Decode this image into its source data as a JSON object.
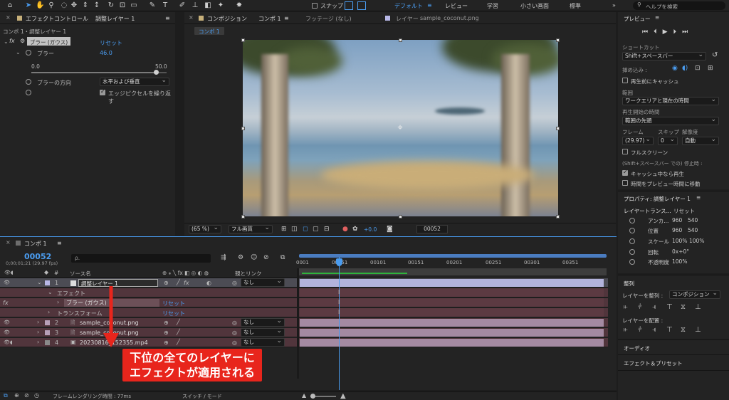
{
  "toolbar": {
    "snap_label": "スナップ",
    "workspaces": [
      "デフォルト",
      "レビュー",
      "学習",
      "小さい画面",
      "標準"
    ],
    "search_placeholder": "ヘルプを検索",
    "more": "»"
  },
  "effect_controls": {
    "tab_label": "エフェクトコントロール",
    "tab_layer": "調整レイヤー 1",
    "breadcrumb": "コンポ 1・調整レイヤー 1",
    "effect_name": "ブラー (ガウス)",
    "reset": "リセット",
    "blur_label": "ブラー",
    "blur_value": "46.0",
    "slider_min": "0.0",
    "slider_max": "50.0",
    "slider_fraction": 0.92,
    "direction_label": "ブラーの方向",
    "direction_value": "水平および垂直",
    "repeat_edge_label": "エッジピクセルを繰り返す"
  },
  "composition": {
    "tab_label": "コンポジション",
    "tab_name": "コンポ 1",
    "footage_tab": "フッテージ (なし)",
    "layer_tab": "レイヤー",
    "layer_name": "sample_coconut.png",
    "comp_chip": "コンポ 1",
    "zoom": "(65 %)",
    "quality": "フル画質",
    "exposure": "+0.0",
    "timecode": "00052"
  },
  "timeline": {
    "tab_label": "コンポ 1",
    "current_frame": "00052",
    "current_time": "0;00;01;21 (29.97 fps)",
    "search_placeholder": "ρ.",
    "col_source": "ソース名",
    "col_parent": "親とリンク",
    "ticks": [
      "0001",
      "00051",
      "00101",
      "00151",
      "00201",
      "00251",
      "00301",
      "00351"
    ],
    "layers": [
      {
        "num": "1",
        "name": "調整レイヤー 1",
        "parent": "なし"
      },
      {
        "num": "2",
        "name": "sample_coconut.png",
        "parent": "なし"
      },
      {
        "num": "3",
        "name": "sample_coconut.png",
        "parent": "なし"
      },
      {
        "num": "4",
        "name": "20230816_152355.mp4",
        "parent": "なし"
      }
    ],
    "effect_group": "エフェクト",
    "effect_item": "ブラー (ガウス)",
    "transform_group": "トランスフォーム",
    "reset": "リセット",
    "fx": "fx",
    "status_label": "フレームレンダリング時間 : 77ms",
    "switch_mode": "スイッチ / モード"
  },
  "annotation": {
    "line1": "下位の全てのレイヤーに",
    "line2": "エフェクトが適用される",
    "color": "#e8251c"
  },
  "preview": {
    "title": "プレビュー",
    "shortcut_label": "ショートカット",
    "shortcut_value": "Shift+スペースバー",
    "include_label": "挿め込み :",
    "cache_before": "再生前にキャッシュ",
    "range_label": "範囲",
    "range_value": "ワークエリアと現在の時間",
    "play_from_label": "再生開始の時間",
    "play_from_value": "範囲の先頭",
    "frame_label": "フレーム",
    "skip_label": "スキップ",
    "resolution_label": "解像度",
    "frame_value": "(29.97)",
    "skip_value": "0",
    "resolution_value": "自動",
    "fullscreen": "フルスクリーン",
    "stop_label": "(Shift+スペースバー での) 停止時 :",
    "stop_cache": "キャッシュ中なら再生",
    "stop_move": "時間をプレビュー時間に移動"
  },
  "properties": {
    "title": "プロパティ: 調整レイヤー 1",
    "transform_label": "レイヤートランス...",
    "reset": "リセット",
    "rows": [
      {
        "label": "アンカ...",
        "v1": "960",
        "v2": "540"
      },
      {
        "label": "位置",
        "v1": "960",
        "v2": "540"
      },
      {
        "label": "スケール",
        "v1": "100%",
        "v2": "100%"
      },
      {
        "label": "回転",
        "v1": "0x+0°",
        "v2": ""
      },
      {
        "label": "不透明度",
        "v1": "100%",
        "v2": ""
      }
    ]
  },
  "align": {
    "title": "整列",
    "align_to_label": "レイヤーを整列 :",
    "align_to_value": "コンポジション",
    "distribute_label": "レイヤーを配置 :"
  },
  "audio": {
    "title": "オーディオ"
  },
  "effects_presets": {
    "title": "エフェクト＆プリセット"
  }
}
